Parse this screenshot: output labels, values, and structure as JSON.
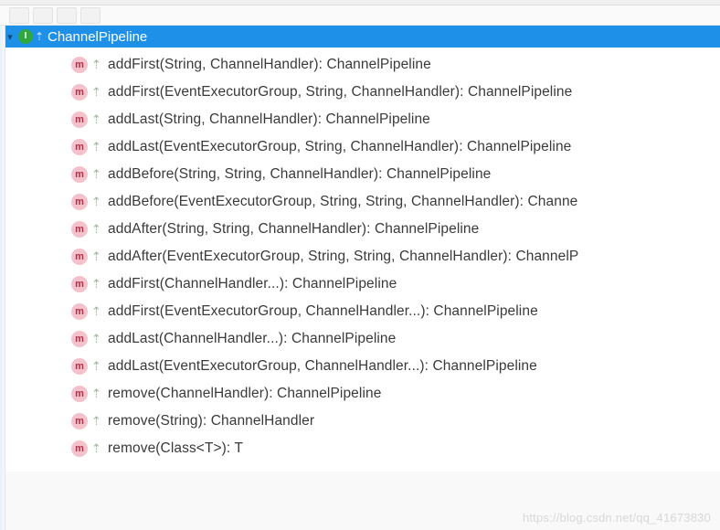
{
  "header": {
    "label": "ChannelPipeline",
    "icon_letter": "I",
    "modifier_glyph": "⇡"
  },
  "method_icon_letter": "m",
  "abstract_glyph": "⇡",
  "methods": [
    {
      "label": "addFirst(String, ChannelHandler): ChannelPipeline"
    },
    {
      "label": "addFirst(EventExecutorGroup, String, ChannelHandler): ChannelPipeline"
    },
    {
      "label": "addLast(String, ChannelHandler): ChannelPipeline"
    },
    {
      "label": "addLast(EventExecutorGroup, String, ChannelHandler): ChannelPipeline"
    },
    {
      "label": "addBefore(String, String, ChannelHandler): ChannelPipeline"
    },
    {
      "label": "addBefore(EventExecutorGroup, String, String, ChannelHandler): Channe"
    },
    {
      "label": "addAfter(String, String, ChannelHandler): ChannelPipeline"
    },
    {
      "label": "addAfter(EventExecutorGroup, String, String, ChannelHandler): ChannelP"
    },
    {
      "label": "addFirst(ChannelHandler...): ChannelPipeline"
    },
    {
      "label": "addFirst(EventExecutorGroup, ChannelHandler...): ChannelPipeline"
    },
    {
      "label": "addLast(ChannelHandler...): ChannelPipeline"
    },
    {
      "label": "addLast(EventExecutorGroup, ChannelHandler...): ChannelPipeline"
    },
    {
      "label": "remove(ChannelHandler): ChannelPipeline"
    },
    {
      "label": "remove(String): ChannelHandler"
    },
    {
      "label": "remove(Class<T>): T"
    }
  ],
  "watermark": "https://blog.csdn.net/qq_41673830"
}
